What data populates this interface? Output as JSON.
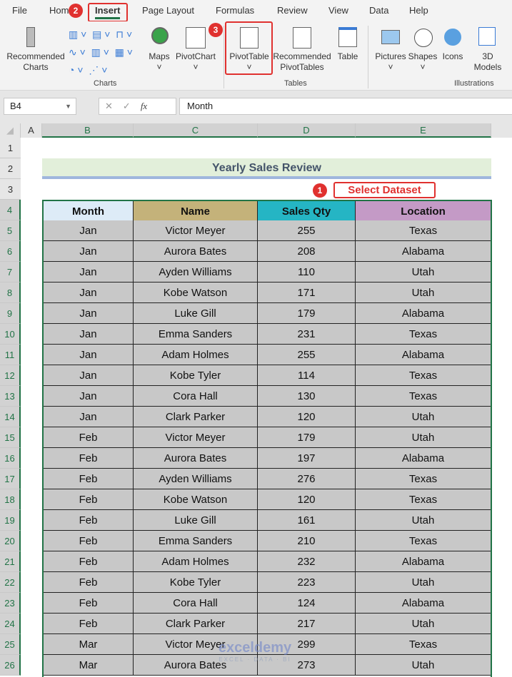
{
  "tabs": [
    "File",
    "Home",
    "Insert",
    "Page Layout",
    "Formulas",
    "Review",
    "View",
    "Data",
    "Help"
  ],
  "ribbon": {
    "recommended_charts": "Recommended Charts",
    "maps": "Maps",
    "pivotchart": "PivotChart",
    "pivottable": "PivotTable",
    "recommended_pivottables": "Recommended PivotTables",
    "table": "Table",
    "pictures": "Pictures",
    "shapes": "Shapes",
    "icons": "Icons",
    "models_3d": "3D Models",
    "group_charts": "Charts",
    "group_tables": "Tables",
    "group_illustrations": "Illustrations"
  },
  "callouts": {
    "step1": "1",
    "step2": "2",
    "step3": "3",
    "select_dataset": "Select Dataset"
  },
  "formula_bar": {
    "name_box": "B4",
    "fx": "fx",
    "value": "Month"
  },
  "columns": [
    "A",
    "B",
    "C",
    "D",
    "E"
  ],
  "title": "Yearly Sales Review",
  "table": {
    "headers": [
      "Month",
      "Name",
      "Sales Qty",
      "Location"
    ],
    "header_colors": [
      "#ddebf7",
      "#c4b27a",
      "#25b5c4",
      "#c49ac6"
    ],
    "rows": [
      [
        "Jan",
        "Victor Meyer",
        "255",
        "Texas"
      ],
      [
        "Jan",
        "Aurora Bates",
        "208",
        "Alabama"
      ],
      [
        "Jan",
        "Ayden Williams",
        "110",
        "Utah"
      ],
      [
        "Jan",
        "Kobe Watson",
        "171",
        "Utah"
      ],
      [
        "Jan",
        "Luke Gill",
        "179",
        "Alabama"
      ],
      [
        "Jan",
        "Emma Sanders",
        "231",
        "Texas"
      ],
      [
        "Jan",
        "Adam Holmes",
        "255",
        "Alabama"
      ],
      [
        "Jan",
        "Kobe Tyler",
        "114",
        "Texas"
      ],
      [
        "Jan",
        "Cora Hall",
        "130",
        "Texas"
      ],
      [
        "Jan",
        "Clark Parker",
        "120",
        "Utah"
      ],
      [
        "Feb",
        "Victor Meyer",
        "179",
        "Utah"
      ],
      [
        "Feb",
        "Aurora Bates",
        "197",
        "Alabama"
      ],
      [
        "Feb",
        "Ayden Williams",
        "276",
        "Texas"
      ],
      [
        "Feb",
        "Kobe Watson",
        "120",
        "Texas"
      ],
      [
        "Feb",
        "Luke Gill",
        "161",
        "Utah"
      ],
      [
        "Feb",
        "Emma Sanders",
        "210",
        "Texas"
      ],
      [
        "Feb",
        "Adam Holmes",
        "232",
        "Alabama"
      ],
      [
        "Feb",
        "Kobe Tyler",
        "223",
        "Utah"
      ],
      [
        "Feb",
        "Cora Hall",
        "124",
        "Alabama"
      ],
      [
        "Feb",
        "Clark Parker",
        "217",
        "Utah"
      ],
      [
        "Mar",
        "Victor Meyer",
        "299",
        "Texas"
      ],
      [
        "Mar",
        "Aurora Bates",
        "273",
        "Utah"
      ]
    ]
  },
  "watermark": {
    "name": "exceldemy",
    "tagline": "EXCEL · DATA · BI"
  }
}
